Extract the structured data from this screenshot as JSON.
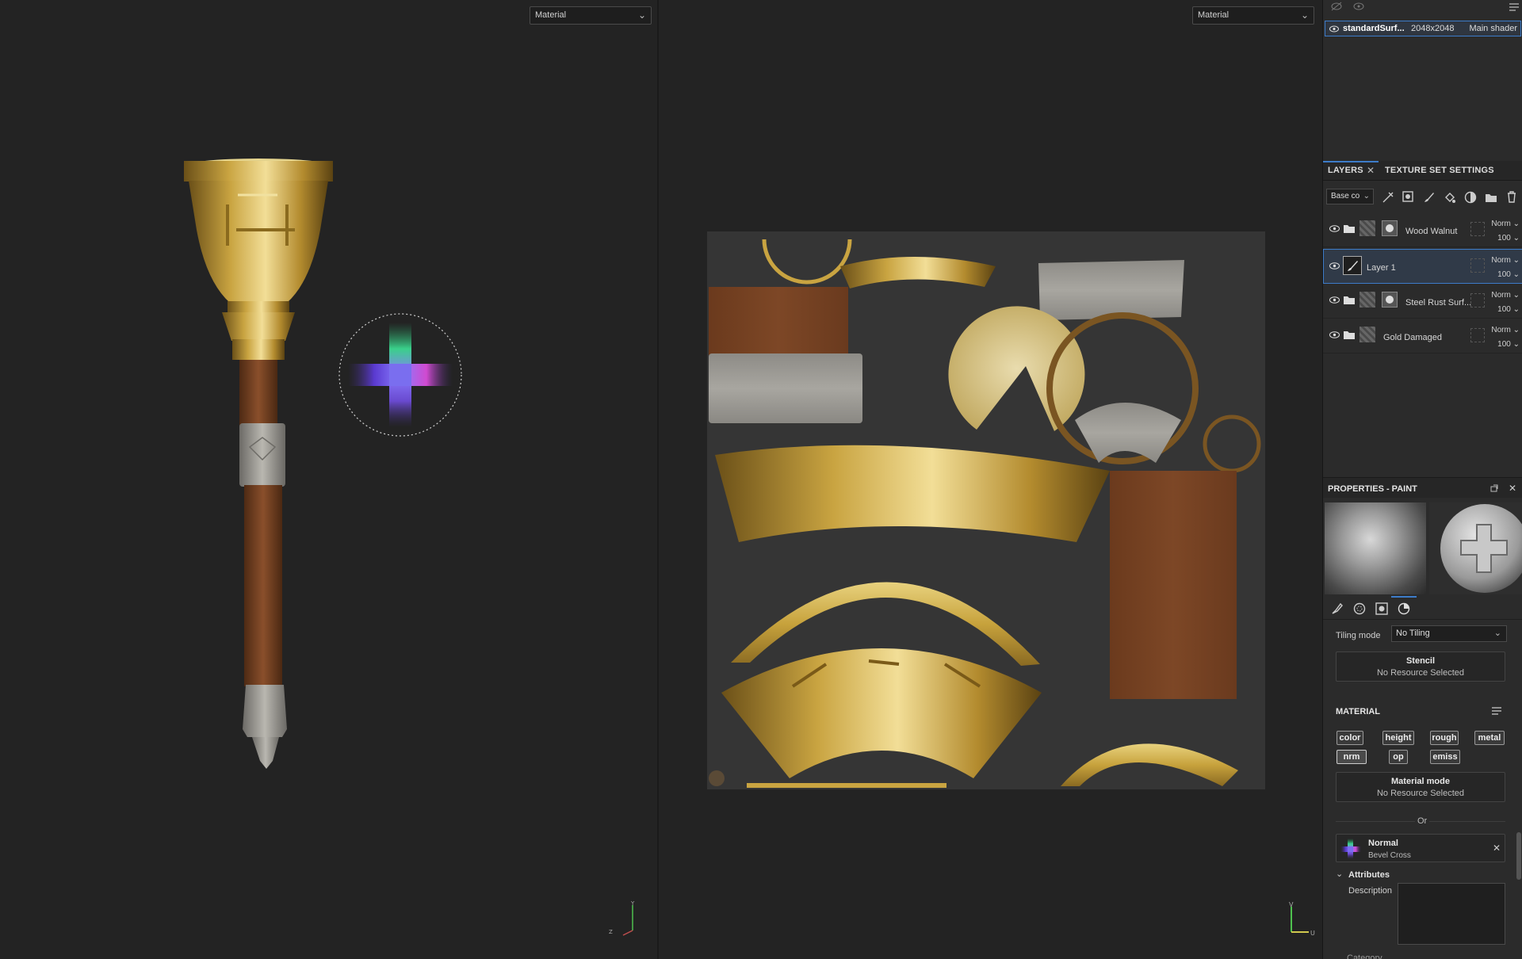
{
  "viewport3d": {
    "mode_select": "Material"
  },
  "viewport2d": {
    "mode_select": "Material"
  },
  "texture_set": {
    "name": "standardSurf...",
    "resolution": "2048x2048",
    "shader": "Main shader"
  },
  "tabs": {
    "layers": "LAYERS",
    "texture_set_settings": "TEXTURE SET SETTINGS"
  },
  "layers_toolbar": {
    "channel_select": "Base co"
  },
  "layers": [
    {
      "name": "Wood Walnut",
      "blend": "Norm",
      "opacity": "100"
    },
    {
      "name": "Layer 1",
      "blend": "Norm",
      "opacity": "100"
    },
    {
      "name": "Steel Rust Surf...",
      "blend": "Norm",
      "opacity": "100"
    },
    {
      "name": "Gold Damaged",
      "blend": "Norm",
      "opacity": "100"
    }
  ],
  "properties": {
    "title": "PROPERTIES - PAINT",
    "tiling_label": "Tiling mode",
    "tiling_value": "No Tiling",
    "stencil_title": "Stencil",
    "stencil_sub": "No Resource Selected",
    "material_label": "MATERIAL",
    "channels": [
      "color",
      "height",
      "rough",
      "metal",
      "nrm",
      "op",
      "emiss"
    ],
    "material_mode_title": "Material mode",
    "material_mode_sub": "No Resource Selected",
    "or_label": "Or",
    "resource_title": "Normal",
    "resource_sub": "Bevel Cross",
    "attributes_label": "Attributes",
    "description_label": "Description",
    "cut_label": "Category"
  },
  "colors": {
    "accent": "#3d7cc9",
    "gold": "#c9a441",
    "wood": "#7a4424",
    "steel": "#9a9a94"
  }
}
